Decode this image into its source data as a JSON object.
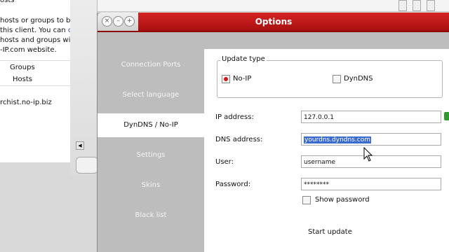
{
  "background_window": {
    "lines": [
      "hosts or groups to be",
      "this client.  You can",
      "hosts and groups with",
      "-IP.com website."
    ],
    "link_text": "cli",
    "groups_label": "Groups",
    "hosts_label": "Hosts",
    "host_entry": "rchist.no-ip.biz"
  },
  "window": {
    "title": "Options",
    "controls": [
      "close-icon",
      "minimize-icon",
      "maximize-icon"
    ]
  },
  "nav": {
    "items": [
      {
        "label": "Connection Ports",
        "active": false
      },
      {
        "label": "Select language",
        "active": false
      },
      {
        "label": "DynDNS / No-IP",
        "active": true
      },
      {
        "label": "Settings",
        "active": false
      },
      {
        "label": "Skins",
        "active": false
      },
      {
        "label": "Black list",
        "active": false
      }
    ]
  },
  "form": {
    "update_type_legend": "Update type",
    "radio_noip": "No-IP",
    "radio_noip_selected": true,
    "radio_dyndns": "DynDNS",
    "radio_dyndns_selected": false,
    "ip_label": "IP address:",
    "ip_value": "127.0.0.1",
    "dns_label": "DNS address:",
    "dns_value": "yourdns.dyndns.com",
    "user_label": "User:",
    "user_value": "username",
    "password_label": "Password:",
    "password_value": "********",
    "show_password_label": "Show password",
    "show_password_checked": false,
    "start_update_label": "Start update"
  },
  "colors": {
    "title_red": "#c01818",
    "selection_blue": "#3a6ad0",
    "nav_bg": "#bdbdbd"
  }
}
